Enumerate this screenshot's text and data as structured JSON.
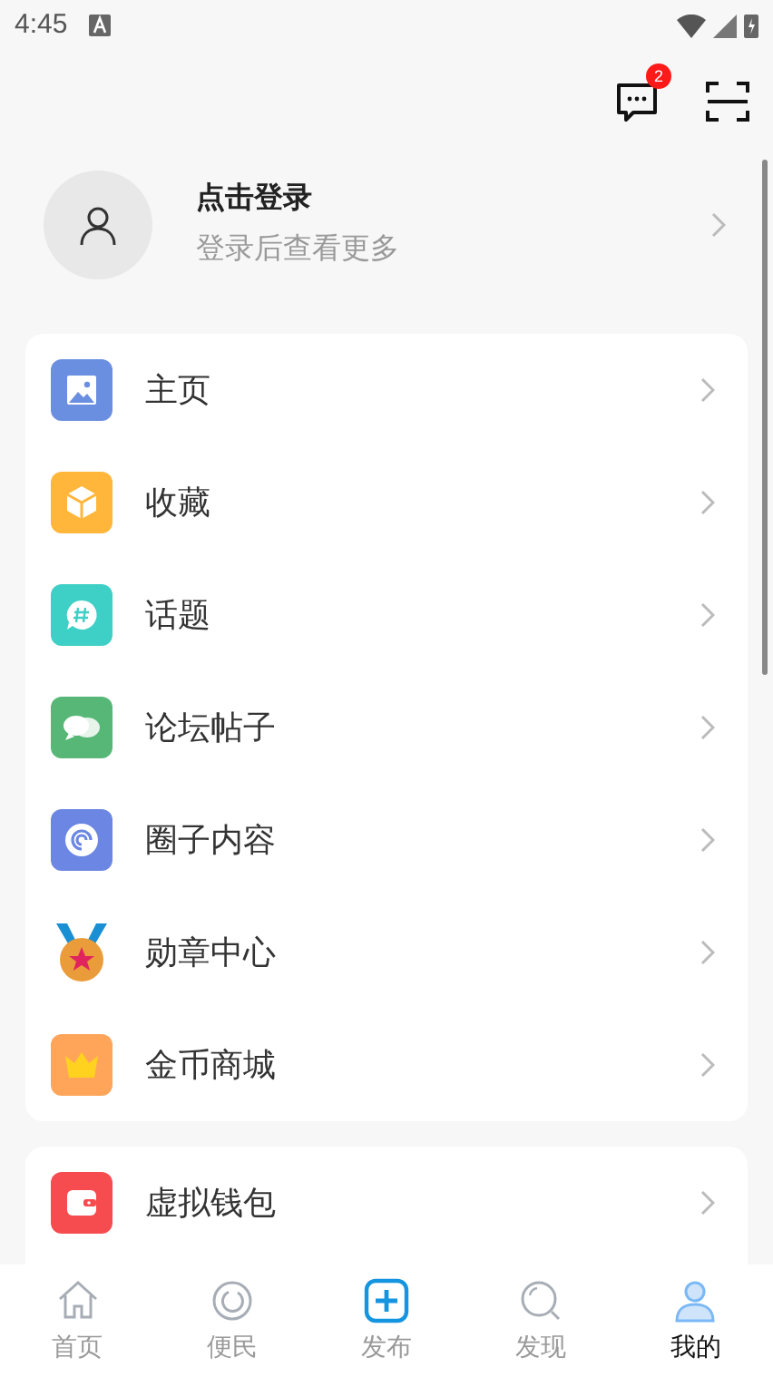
{
  "status_bar": {
    "time": "4:45"
  },
  "header": {
    "message_badge": "2"
  },
  "profile": {
    "title": "点击登录",
    "subtitle": "登录后查看更多"
  },
  "menu_groups": [
    {
      "items": [
        {
          "label": "主页",
          "kind": "image",
          "color": "#6a8fe0"
        },
        {
          "label": "收藏",
          "kind": "box",
          "color": "#ffb63a"
        },
        {
          "label": "话题",
          "kind": "topic",
          "color": "#3ecfc6"
        },
        {
          "label": "论坛帖子",
          "kind": "chat",
          "color": "#56b776"
        },
        {
          "label": "圈子内容",
          "kind": "spiral",
          "color": "#6b86e3"
        },
        {
          "label": "勋章中心",
          "kind": "medal",
          "color": "#ea9c3b"
        },
        {
          "label": "金币商城",
          "kind": "crown",
          "color": "#ffa55a"
        }
      ]
    },
    {
      "items": [
        {
          "label": "虚拟钱包",
          "kind": "wallet",
          "color": "#f64c4f"
        }
      ]
    }
  ],
  "bottom_nav": [
    {
      "label": "首页",
      "kind": "home",
      "selected": false
    },
    {
      "label": "便民",
      "kind": "ring",
      "selected": false
    },
    {
      "label": "发布",
      "kind": "plus",
      "selected": false
    },
    {
      "label": "发现",
      "kind": "search",
      "selected": false
    },
    {
      "label": "我的",
      "kind": "user",
      "selected": true
    }
  ]
}
